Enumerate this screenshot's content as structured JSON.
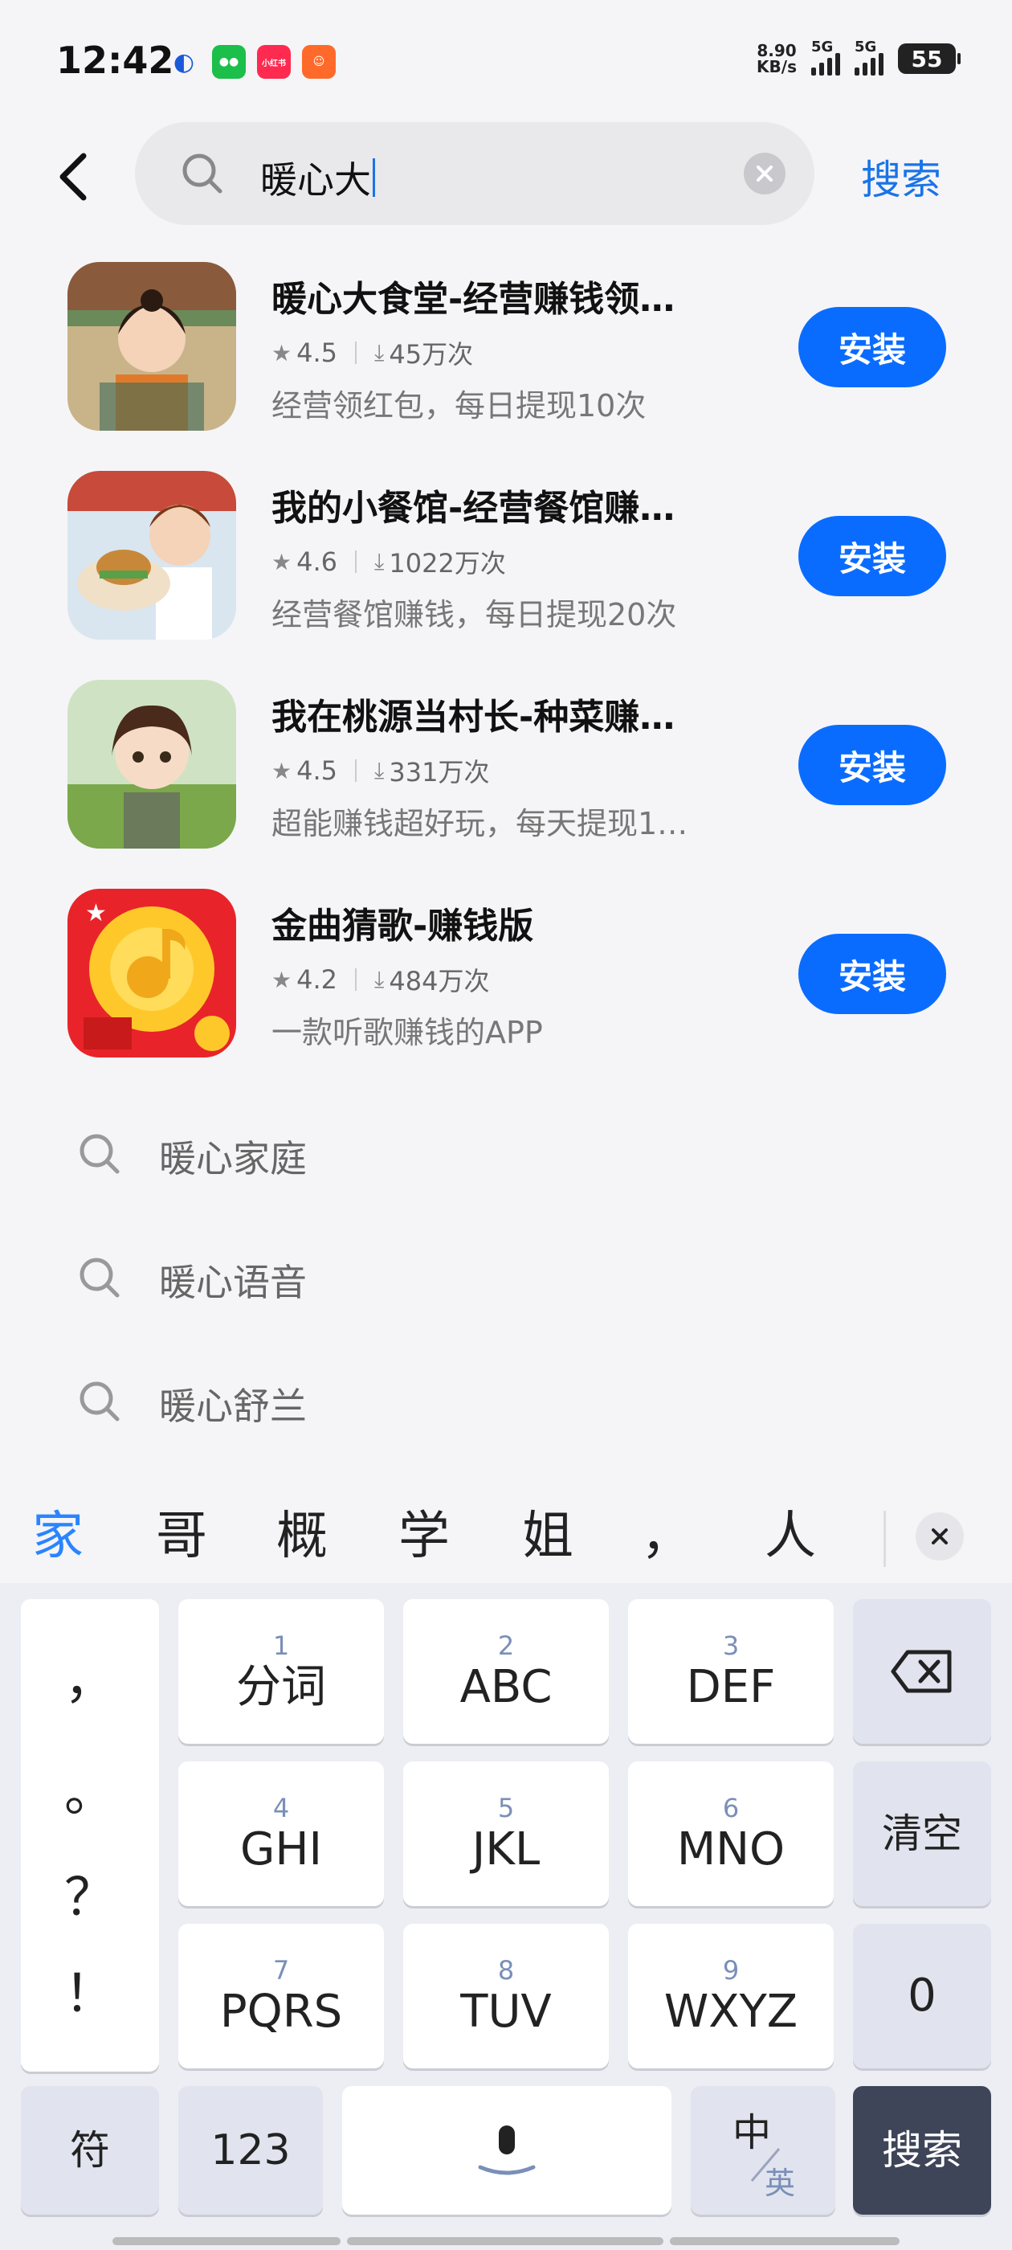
{
  "status_bar": {
    "time": "12:42",
    "net_speed_value": "8.90",
    "net_speed_unit": "KB/s",
    "signal_1_label": "5G",
    "signal_2_label": "5G",
    "battery": "55",
    "notification_icons": [
      "browser-icon",
      "wechat-icon",
      "xiaohongshu-icon",
      "taobao-icon"
    ]
  },
  "search": {
    "query": "暖心大",
    "action_label": "搜索"
  },
  "results": [
    {
      "title": "暖心大食堂-经营赚钱领…",
      "rating": "4.5",
      "downloads": "45万次",
      "description": "经营领红包，每日提现10次",
      "install_label": "安装"
    },
    {
      "title": "我的小餐馆-经营餐馆赚…",
      "rating": "4.6",
      "downloads": "1022万次",
      "description": "经营餐馆赚钱，每日提现20次",
      "install_label": "安装"
    },
    {
      "title": "我在桃源当村长-种菜赚…",
      "rating": "4.5",
      "downloads": "331万次",
      "description": "超能赚钱超好玩，每天提现1…",
      "install_label": "安装"
    },
    {
      "title": "金曲猜歌-赚钱版",
      "rating": "4.2",
      "downloads": "484万次",
      "description": "一款听歌赚钱的APP",
      "install_label": "安装"
    }
  ],
  "suggestions": [
    "暖心家庭",
    "暖心语音",
    "暖心舒兰"
  ],
  "candidates": [
    "家",
    "哥",
    "概",
    "学",
    "姐",
    "，",
    "人"
  ],
  "keyboard": {
    "punctuation": [
      "，",
      "。",
      "？",
      "！"
    ],
    "keys": [
      {
        "num": "1",
        "label": "分词"
      },
      {
        "num": "2",
        "label": "ABC"
      },
      {
        "num": "3",
        "label": "DEF"
      },
      {
        "num": "4",
        "label": "GHI"
      },
      {
        "num": "5",
        "label": "JKL"
      },
      {
        "num": "6",
        "label": "MNO"
      },
      {
        "num": "7",
        "label": "PQRS"
      },
      {
        "num": "8",
        "label": "TUV"
      },
      {
        "num": "9",
        "label": "WXYZ"
      }
    ],
    "clear_label": "清空",
    "zero_label": "0",
    "symbol_label": "符",
    "numeric_label": "123",
    "lang_primary": "中",
    "lang_secondary": "英",
    "search_label": "搜索"
  },
  "colors": {
    "accent": "#0a6cff",
    "link": "#1a73e8",
    "candidate_highlight": "#2a84ff",
    "keyboard_dark": "#3e4558"
  }
}
